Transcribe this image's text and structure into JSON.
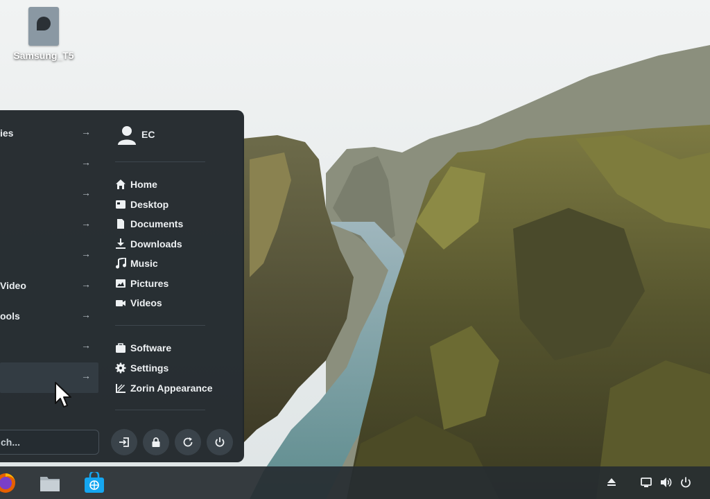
{
  "desktop": {
    "icon_label": "Samsung_T5"
  },
  "start_menu": {
    "categories": [
      {
        "label": "ies"
      },
      {
        "label": ""
      },
      {
        "label": ""
      },
      {
        "label": ""
      },
      {
        "label": ""
      },
      {
        "label": "Video"
      },
      {
        "label": "ools"
      },
      {
        "label": ""
      },
      {
        "label": ""
      }
    ],
    "user_name": "EC",
    "places": [
      {
        "label": "Home",
        "icon": "home-icon"
      },
      {
        "label": "Desktop",
        "icon": "desktop-icon"
      },
      {
        "label": "Documents",
        "icon": "document-icon"
      },
      {
        "label": "Downloads",
        "icon": "download-icon"
      },
      {
        "label": "Music",
        "icon": "music-icon"
      },
      {
        "label": "Pictures",
        "icon": "picture-icon"
      },
      {
        "label": "Videos",
        "icon": "video-icon"
      }
    ],
    "system": [
      {
        "label": "Software",
        "icon": "software-bag-icon"
      },
      {
        "label": "Settings",
        "icon": "gear-icon"
      },
      {
        "label": "Zorin Appearance",
        "icon": "appearance-icon"
      }
    ],
    "search_placeholder": "ch...",
    "power_buttons": [
      "logout-icon",
      "lock-icon",
      "restart-icon",
      "power-icon"
    ]
  },
  "taskbar": {
    "apps": [
      "firefox-icon",
      "files-icon",
      "software-store-icon"
    ],
    "tray": [
      "eject-icon",
      "display-icon",
      "volume-icon",
      "power-icon"
    ]
  },
  "colors": {
    "menu_bg": "#20262b",
    "accent": "#15a6f0",
    "text": "#e8ecef"
  }
}
